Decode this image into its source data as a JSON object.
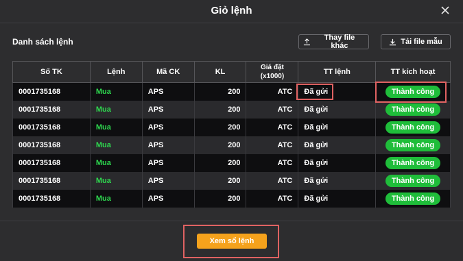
{
  "dialog": {
    "title": "Giỏ lệnh",
    "close_icon": "close-icon"
  },
  "toolbar": {
    "list_title": "Danh sách lệnh",
    "replace_label": "Thay file khác",
    "download_label": "Tải file mẫu"
  },
  "table": {
    "headers": [
      "Số TK",
      "Lệnh",
      "Mã CK",
      "KL",
      "Giá đặt\n(x1000)",
      "TT lệnh",
      "TT kích hoạt"
    ],
    "rows": [
      {
        "account": "0001735168",
        "side": "Mua",
        "symbol": "APS",
        "qty": "200",
        "price": "ATC",
        "order_status": "Đã gửi",
        "activation": "Thành công"
      },
      {
        "account": "0001735168",
        "side": "Mua",
        "symbol": "APS",
        "qty": "200",
        "price": "ATC",
        "order_status": "Đã gửi",
        "activation": "Thành công"
      },
      {
        "account": "0001735168",
        "side": "Mua",
        "symbol": "APS",
        "qty": "200",
        "price": "ATC",
        "order_status": "Đã gửi",
        "activation": "Thành công"
      },
      {
        "account": "0001735168",
        "side": "Mua",
        "symbol": "APS",
        "qty": "200",
        "price": "ATC",
        "order_status": "Đã gửi",
        "activation": "Thành công"
      },
      {
        "account": "0001735168",
        "side": "Mua",
        "symbol": "APS",
        "qty": "200",
        "price": "ATC",
        "order_status": "Đã gửi",
        "activation": "Thành công"
      },
      {
        "account": "0001735168",
        "side": "Mua",
        "symbol": "APS",
        "qty": "200",
        "price": "ATC",
        "order_status": "Đã gửi",
        "activation": "Thành công"
      },
      {
        "account": "0001735168",
        "side": "Mua",
        "symbol": "APS",
        "qty": "200",
        "price": "ATC",
        "order_status": "Đã gửi",
        "activation": "Thành công"
      }
    ]
  },
  "footer": {
    "view_orders_label": "Xem sổ lệnh"
  },
  "colors": {
    "accent": "#f5a21c",
    "buy": "#2ed94f",
    "success": "#1fbd3a",
    "highlight": "#e06262"
  }
}
